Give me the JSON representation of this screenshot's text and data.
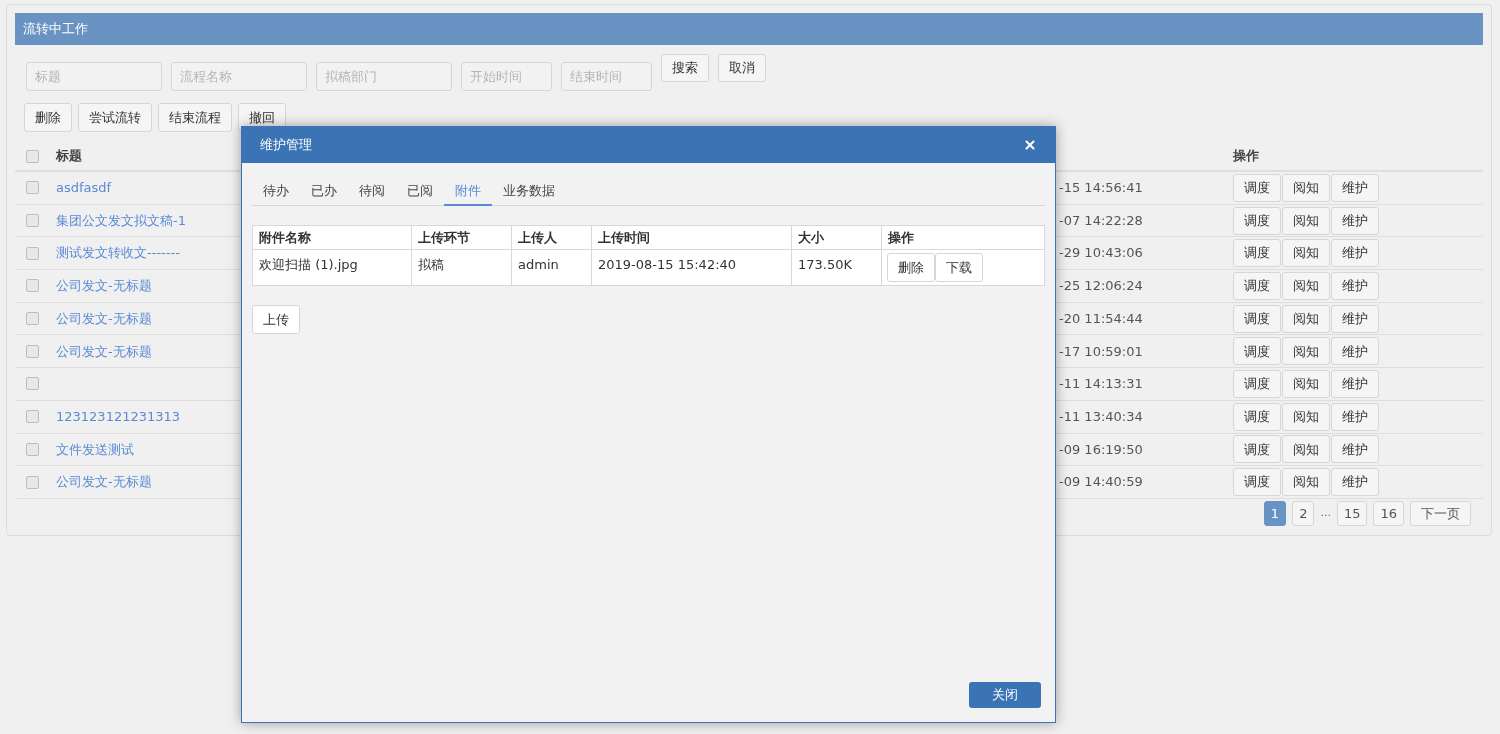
{
  "panel": {
    "title": "流转中工作"
  },
  "filters": [
    {
      "placeholder": "标题"
    },
    {
      "placeholder": "流程名称"
    },
    {
      "placeholder": "拟稿部门"
    },
    {
      "placeholder": "开始时间",
      "kind": "date"
    },
    {
      "placeholder": "结束时间",
      "kind": "date"
    }
  ],
  "search_buttons": [
    "搜索",
    "取消"
  ],
  "toolbar": [
    "删除",
    "尝试流转",
    "结束流程",
    "撤回"
  ],
  "table": {
    "select_all": {
      "checked": false
    },
    "columns": {
      "title": "标题",
      "actions": "操作"
    },
    "rows": [
      {
        "checked": false,
        "title": "asdfasdf",
        "time": "-15 14:56:41",
        "actions": [
          "调度",
          "阅知",
          "维护"
        ]
      },
      {
        "checked": false,
        "title": "集团公文发文拟文稿-1",
        "time": "-07 14:22:28",
        "actions": [
          "调度",
          "阅知",
          "维护"
        ]
      },
      {
        "checked": false,
        "title": "测试发文转收文-------",
        "time": "-29 10:43:06",
        "actions": [
          "调度",
          "阅知",
          "维护"
        ]
      },
      {
        "checked": false,
        "title": "公司发文-无标题",
        "time": "-25 12:06:24",
        "actions": [
          "调度",
          "阅知",
          "维护"
        ]
      },
      {
        "checked": false,
        "title": "公司发文-无标题",
        "time": "-20 11:54:44",
        "actions": [
          "调度",
          "阅知",
          "维护"
        ]
      },
      {
        "checked": false,
        "title": "公司发文-无标题",
        "time": "-17 10:59:01",
        "actions": [
          "调度",
          "阅知",
          "维护"
        ]
      },
      {
        "checked": false,
        "time": "-11 14:13:31",
        "actions": [
          "调度",
          "阅知",
          "维护"
        ]
      },
      {
        "checked": false,
        "title": "123123121231313",
        "time": "-11 13:40:34",
        "actions": [
          "调度",
          "阅知",
          "维护"
        ]
      },
      {
        "checked": false,
        "title": "文件发送测试",
        "time": "-09 16:19:50",
        "actions": [
          "调度",
          "阅知",
          "维护"
        ]
      },
      {
        "checked": false,
        "title": "公司发文-无标题",
        "time": "-09 14:40:59",
        "actions": [
          "调度",
          "阅知",
          "维护"
        ]
      }
    ]
  },
  "pagination": {
    "pages": [
      {
        "label": "1",
        "selected": true
      },
      {
        "label": "2",
        "selected": false
      },
      {
        "kind": "ellipsis",
        "label": "..."
      },
      {
        "label": "15",
        "selected": false
      },
      {
        "label": "16",
        "selected": false
      }
    ],
    "next": "下一页"
  },
  "dialog": {
    "title": "维护管理",
    "tabs": [
      {
        "label": "待办",
        "selected": false
      },
      {
        "label": "已办",
        "selected": false
      },
      {
        "label": "待阅",
        "selected": false
      },
      {
        "label": "已阅",
        "selected": false
      },
      {
        "label": "附件",
        "selected": true
      },
      {
        "label": "业务数据",
        "selected": false
      }
    ],
    "attachments": {
      "columns": [
        "附件名称",
        "上传环节",
        "上传人",
        "上传时间",
        "大小",
        "操作"
      ],
      "rows": [
        {
          "cells": [
            "欢迎扫描 (1).jpg",
            "拟稿",
            "admin",
            "2019-08-15 15:42:40",
            "173.50K"
          ],
          "actions": [
            "删除",
            "下载"
          ]
        }
      ]
    },
    "upload_button": "上传",
    "close_button": "关闭"
  }
}
